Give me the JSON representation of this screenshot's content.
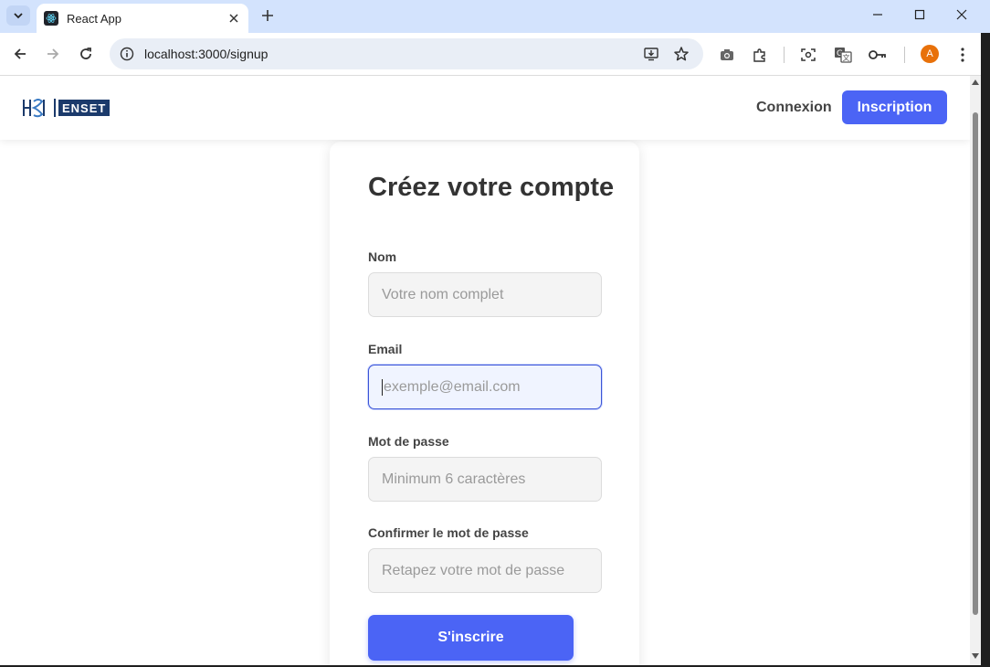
{
  "browser": {
    "tab_title": "React App",
    "url": "localhost:3000/signup",
    "profile_initial": "A",
    "icons": {
      "tab_search": "chevron-down-icon",
      "tab_close": "close-icon",
      "new_tab": "plus-icon",
      "minimize": "minimize-icon",
      "maximize": "maximize-icon",
      "close_window": "close-icon",
      "back": "arrow-left-icon",
      "forward": "arrow-right-icon",
      "reload": "reload-icon",
      "site_info": "info-icon",
      "install": "install-icon",
      "bookmark": "star-icon",
      "screenshot": "camera-icon",
      "extensions": "puzzle-icon",
      "lens": "lens-icon",
      "translate": "translate-icon",
      "passwords": "key-icon",
      "menu": "kebab-menu-icon"
    }
  },
  "navbar": {
    "logo_text": "ENSET",
    "login_link": "Connexion",
    "signup_button": "Inscription"
  },
  "form": {
    "title": "Créez votre compte",
    "fields": [
      {
        "label": "Nom",
        "placeholder": "Votre nom complet",
        "value": ""
      },
      {
        "label": "Email",
        "placeholder": "exemple@email.com",
        "value": ""
      },
      {
        "label": "Mot de passe",
        "placeholder": "Minimum 6 caractères",
        "value": ""
      },
      {
        "label": "Confirmer le mot de passe",
        "placeholder": "Retapez votre mot de passe",
        "value": ""
      }
    ],
    "submit_label": "S'inscrire"
  },
  "colors": {
    "accent": "#4b64f5",
    "tabbar": "#d3e3fd",
    "logo": "#1b3a6b"
  }
}
